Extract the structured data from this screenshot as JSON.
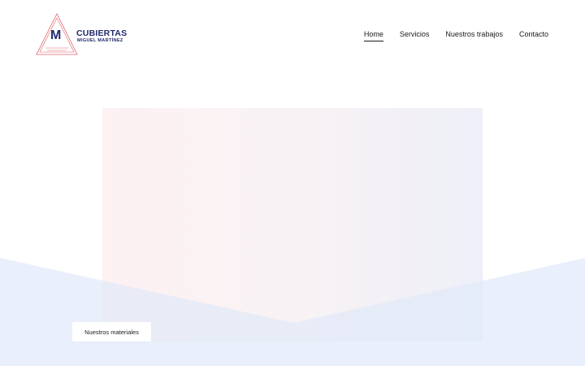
{
  "logo": {
    "letter": "M",
    "name": "CUBIERTAS",
    "subtitle": "MIGUEL MARTÍNEZ"
  },
  "nav": {
    "items": [
      {
        "label": "Home",
        "active": true
      },
      {
        "label": "Servicios",
        "active": false
      },
      {
        "label": "Nuestros trabajos",
        "active": false
      },
      {
        "label": "Contacto",
        "active": false
      }
    ]
  },
  "hero": {
    "button_label": "Nuestros materiales"
  },
  "colors": {
    "brand_navy": "#1f2a6b",
    "logo_lines": "#e0616b",
    "hero_band": "#e9effb"
  }
}
